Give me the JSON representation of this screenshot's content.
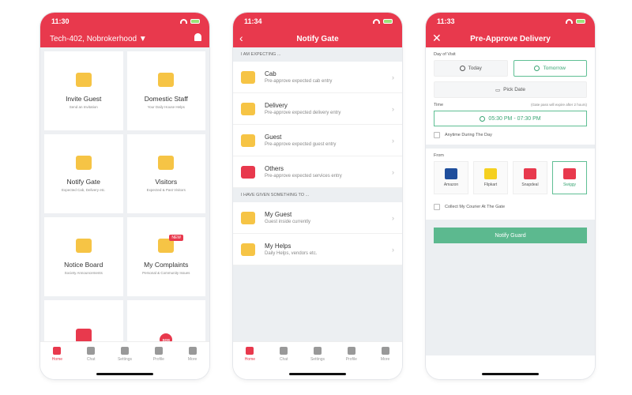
{
  "screen1": {
    "time": "11:30",
    "location": "Tech-402, Nobrokerhood ▼",
    "tiles": [
      {
        "title": "Invite Guest",
        "sub": "Send an Invitation",
        "icon": "envelope-icon",
        "color": "#f6c445"
      },
      {
        "title": "Domestic Staff",
        "sub": "Your Daily House Helps",
        "icon": "house-icon",
        "color": "#f6c445"
      },
      {
        "title": "Notify Gate",
        "sub": "Expected Cab, Delivery etc.",
        "icon": "bell-icon",
        "color": "#f6c445"
      },
      {
        "title": "Visitors",
        "sub": "Expected & Past Visitors",
        "icon": "id-card-icon",
        "color": "#f6c445"
      },
      {
        "title": "Notice Board",
        "sub": "Society Announcements",
        "icon": "megaphone-icon",
        "color": "#f6c445"
      },
      {
        "title": "My Complaints",
        "sub": "Personal & Community Issues",
        "icon": "map-icon",
        "color": "#f6c445",
        "badge": "NEW"
      },
      {
        "title": "",
        "sub": "",
        "icon": "tools-icon",
        "color": "#e8394d"
      },
      {
        "title": "",
        "sub": "",
        "icon": "sos-icon",
        "sos": "SOS"
      }
    ]
  },
  "screen2": {
    "time": "11:34",
    "title": "Notify Gate",
    "section1": "I AM EXPECTING ...",
    "section2": "I HAVE GIVEN SOMETHING TO ...",
    "expecting": [
      {
        "title": "Cab",
        "sub": "Pre-approve expected cab entry",
        "icon": "cab-icon"
      },
      {
        "title": "Delivery",
        "sub": "Pre-approve expected delivery entry",
        "icon": "scooter-icon"
      },
      {
        "title": "Guest",
        "sub": "Pre-approve expected guest entry",
        "icon": "guest-icon"
      },
      {
        "title": "Others",
        "sub": "Pre-approve expected services entry",
        "icon": "tools-icon"
      }
    ],
    "given": [
      {
        "title": "My Guest",
        "sub": "Guest inside currently",
        "icon": "guest-icon"
      },
      {
        "title": "My Helps",
        "sub": "Daily Helps, vendors etc.",
        "icon": "vacuum-icon"
      }
    ]
  },
  "screen3": {
    "time": "11:33",
    "title": "Pre-Approve Delivery",
    "day_label": "Day of Visit",
    "today": "Today",
    "tomorrow": "Tomorrow",
    "pick_date": "Pick Date",
    "time_label": "Time",
    "time_hint": "(Gate pass will expire after 2 hours)",
    "time_value": "05:30 PM - 07:30 PM",
    "anytime": "Anytime During The Day",
    "from_label": "From",
    "merchants": [
      {
        "name": "Amazon",
        "color": "#1f4e9c"
      },
      {
        "name": "Flipkart",
        "color": "#f5d020"
      },
      {
        "name": "Snapdeal",
        "color": "#e8394d"
      },
      {
        "name": "Swiggy",
        "color": "#e8394d"
      }
    ],
    "collect": "Collect My Courier At The Gate",
    "notify": "Notify Guard"
  },
  "tabbar": [
    {
      "label": "Home",
      "icon": "home-icon"
    },
    {
      "label": "Chat",
      "icon": "chat-icon"
    },
    {
      "label": "Settings",
      "icon": "gear-icon"
    },
    {
      "label": "Profile",
      "icon": "profile-icon"
    },
    {
      "label": "More",
      "icon": "more-icon"
    }
  ],
  "colors": {
    "brand": "#e8394d",
    "accent": "#5cb98f"
  }
}
